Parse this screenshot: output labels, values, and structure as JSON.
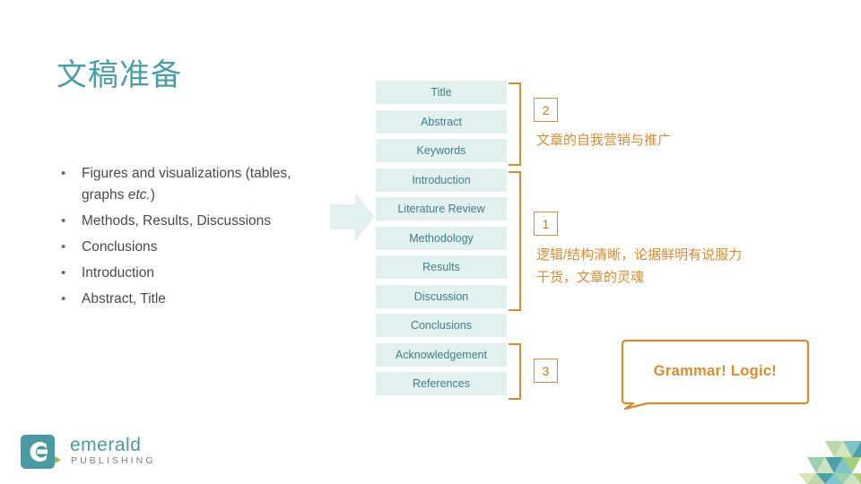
{
  "slide": {
    "title": "文稿准备"
  },
  "bullets": [
    {
      "marker": "•",
      "text": "Figures and visualizations (tables, graphs etc.)"
    },
    {
      "marker": "•",
      "text": "Methods, Results, Discussions"
    },
    {
      "marker": "•",
      "text": "Conclusions"
    },
    {
      "marker": "•",
      "text": "Introduction"
    },
    {
      "marker": "•",
      "text": "Abstract, Title"
    }
  ],
  "flow_boxes": [
    {
      "label": "Title"
    },
    {
      "label": "Abstract"
    },
    {
      "label": "Keywords"
    },
    {
      "label": "Introduction"
    },
    {
      "label": "Literature Review"
    },
    {
      "label": "Methodology"
    },
    {
      "label": "Results"
    },
    {
      "label": "Discussion"
    },
    {
      "label": "Conclusions"
    },
    {
      "label": "Acknowledgement"
    },
    {
      "label": "References"
    }
  ],
  "annotations": [
    {
      "badge": "2",
      "text": "文章的自我营销与推广"
    },
    {
      "badge": "1",
      "text": "逻辑/结构清晰，论据鲜明有说服力\n干货，文章的灵魂"
    },
    {
      "badge": "3",
      "text": ""
    }
  ],
  "callout": {
    "text": "Grammar!  Logic!"
  },
  "logo": {
    "name": "emerald",
    "tagline": "PUBLISHING"
  },
  "colors": {
    "teal": "#4aa0a8",
    "box_fill": "#e3f0f0",
    "box_text": "#3f7f86",
    "orange": "#d98b30",
    "body_text": "#4a4a4a"
  }
}
